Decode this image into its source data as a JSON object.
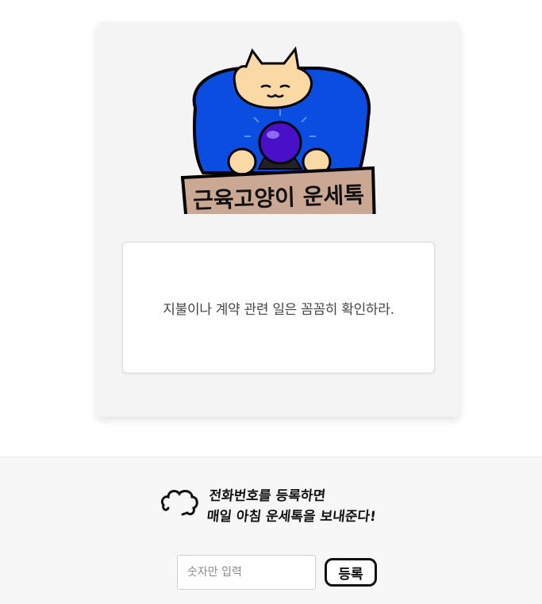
{
  "logo": {
    "title": "근육고양이 운세톡",
    "icon": "muscle-cat-crystal-ball-logo"
  },
  "fortune": {
    "text": "지불이나 계약 관련 일은 꼼꼼히 확인하라."
  },
  "signup": {
    "promo_line1": "전화번호를 등록하면",
    "promo_line2": "매일 아침 운세톡을 보내준다!",
    "cloud_icon": "cloud-icon",
    "input_placeholder": "숫자만 입력",
    "button_label": "등록"
  },
  "colors": {
    "card_bg": "#f4f4f4",
    "cat_shirt": "#0a4de0",
    "crystal_ball": "#4a10c8",
    "sign_board": "#caa893",
    "cat_fur": "#fbd9a4"
  }
}
